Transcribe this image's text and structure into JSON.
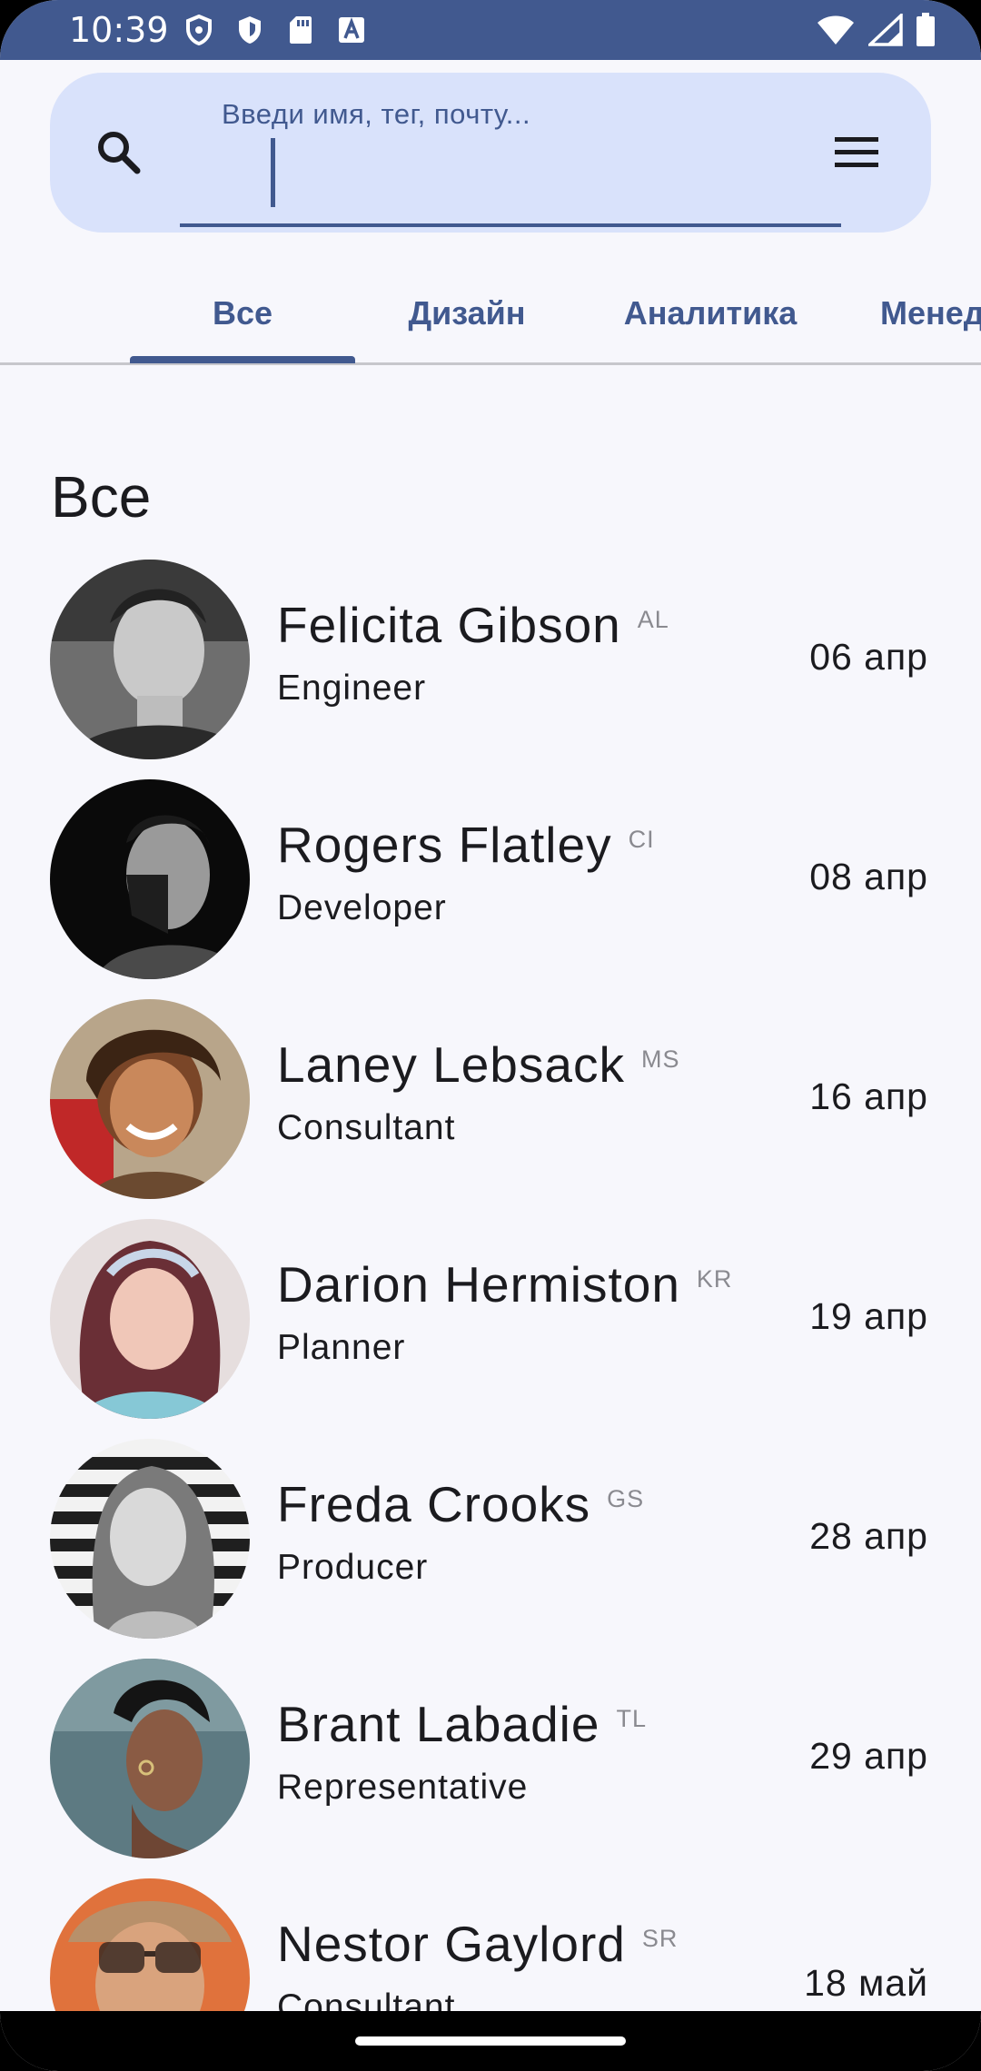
{
  "status_bar": {
    "time": "10:39",
    "left_icons": [
      "shield-outline-icon",
      "shield-filled-icon",
      "sd-card-icon",
      "font-a-icon"
    ],
    "right_icons": [
      "wifi-icon",
      "cellular-signal-icon",
      "battery-icon"
    ]
  },
  "search": {
    "placeholder": "Введи имя, тег, почту...",
    "value": ""
  },
  "tabs": [
    {
      "label": "Все",
      "selected": true
    },
    {
      "label": "Дизайн",
      "selected": false
    },
    {
      "label": "Аналитика",
      "selected": false
    },
    {
      "label": "Менед",
      "selected": false
    }
  ],
  "section_title": "Все",
  "contacts": [
    {
      "name": "Felicita Gibson",
      "tag": "AL",
      "role": "Engineer",
      "date": "06 апр"
    },
    {
      "name": "Rogers Flatley",
      "tag": "CI",
      "role": "Developer",
      "date": "08 апр"
    },
    {
      "name": "Laney Lebsack",
      "tag": "MS",
      "role": "Consultant",
      "date": "16 апр"
    },
    {
      "name": "Darion Hermiston",
      "tag": "KR",
      "role": "Planner",
      "date": "19 апр"
    },
    {
      "name": "Freda Crooks",
      "tag": "GS",
      "role": "Producer",
      "date": "28 апр"
    },
    {
      "name": "Brant Labadie",
      "tag": "TL",
      "role": "Representative",
      "date": "29 апр"
    },
    {
      "name": "Nestor Gaylord",
      "tag": "SR",
      "role": "Consultant",
      "date": "18 май"
    }
  ],
  "colors": {
    "primary": "#41598f",
    "search_bg": "#d9e2fb",
    "background": "#f7f7fc",
    "text": "#1b1b1f",
    "tag_text": "#8a8a90"
  }
}
